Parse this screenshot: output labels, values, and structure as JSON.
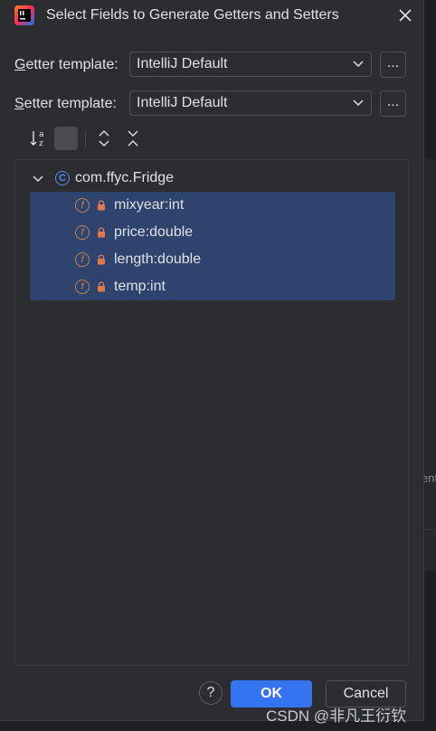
{
  "dialog": {
    "title": "Select Fields to Generate Getters and Setters",
    "getter": {
      "label_mnemonic": "G",
      "label_rest": "etter template:",
      "value": "IntelliJ Default",
      "browse_label": "..."
    },
    "setter": {
      "label_mnemonic": "S",
      "label_rest": "etter template:",
      "value": "IntelliJ Default",
      "browse_label": "..."
    },
    "toolbar": {
      "sort_icon": "sort-alphabetically-icon",
      "expand_icon": "expand-all-icon",
      "collapse_icon": "collapse-all-icon"
    },
    "tree": {
      "root": {
        "label": "com.ffyc.Fridge",
        "icon_letter": "C"
      },
      "fields": [
        {
          "label": "mixyear:int",
          "icon_letter": "f"
        },
        {
          "label": "price:double",
          "icon_letter": "f"
        },
        {
          "label": "length:double",
          "icon_letter": "f"
        },
        {
          "label": "temp:int",
          "icon_letter": "f"
        }
      ]
    },
    "buttons": {
      "help": "?",
      "ok": "OK",
      "cancel": "Cancel"
    }
  },
  "background": {
    "partial_text": "ent"
  },
  "watermark": "CSDN @非凡王衍钦",
  "colors": {
    "accent": "#3574f0",
    "selection": "#2e436e",
    "class_icon": "#548af7",
    "field_icon": "#c9824a"
  }
}
